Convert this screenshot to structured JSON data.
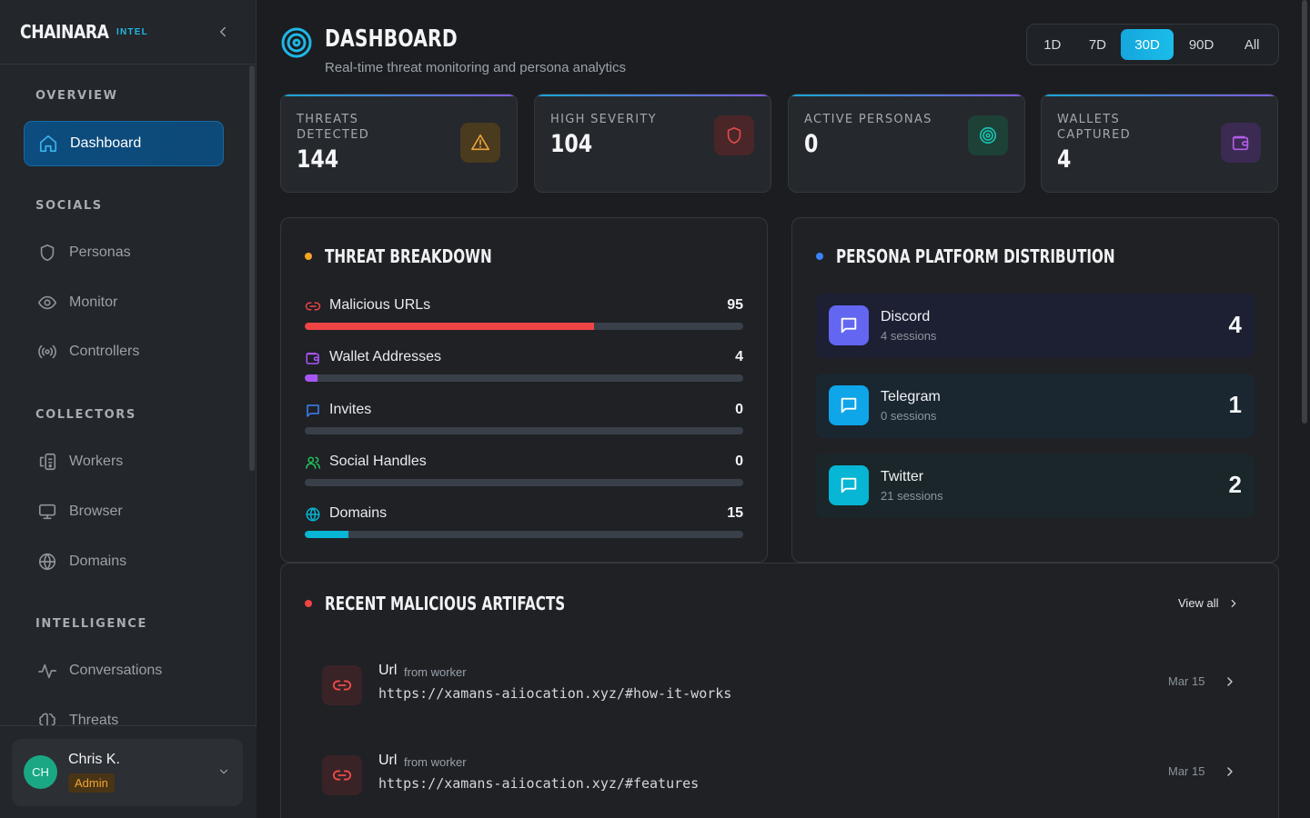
{
  "brand": {
    "name": "CHAINARA",
    "tag": "INTEL"
  },
  "sidebar": {
    "sections": [
      {
        "title": "OVERVIEW",
        "items": [
          {
            "label": "Dashboard",
            "icon": "home-icon",
            "active": true
          }
        ]
      },
      {
        "title": "SOCIALS",
        "items": [
          {
            "label": "Personas",
            "icon": "shield-icon"
          },
          {
            "label": "Monitor",
            "icon": "eye-icon"
          },
          {
            "label": "Controllers",
            "icon": "radio-icon"
          }
        ]
      },
      {
        "title": "COLLECTORS",
        "items": [
          {
            "label": "Workers",
            "icon": "worker-icon"
          },
          {
            "label": "Browser",
            "icon": "monitor-icon"
          },
          {
            "label": "Domains",
            "icon": "globe-icon"
          }
        ]
      },
      {
        "title": "INTELLIGENCE",
        "items": [
          {
            "label": "Conversations",
            "icon": "activity-icon"
          },
          {
            "label": "Threats",
            "icon": "brain-icon"
          }
        ]
      }
    ]
  },
  "user": {
    "initials": "CH",
    "name": "Chris K.",
    "role": "Admin"
  },
  "header": {
    "title": "DASHBOARD",
    "subtitle": "Real-time threat monitoring and persona analytics",
    "ranges": [
      "1D",
      "7D",
      "30D",
      "90D",
      "All"
    ],
    "active_range": "30D"
  },
  "stats": [
    {
      "label": "THREATS DETECTED",
      "value": "144",
      "icon": "alert-triangle-icon",
      "color": "#e9a23b",
      "bg": "#4a3a1e"
    },
    {
      "label": "HIGH SEVERITY",
      "value": "104",
      "icon": "shield-icon",
      "color": "#e04a4a",
      "bg": "#4a2628"
    },
    {
      "label": "ACTIVE PERSONAS",
      "value": "0",
      "icon": "target-icon",
      "color": "#19c0b0",
      "bg": "#1d4136"
    },
    {
      "label": "WALLETS CAPTURED",
      "value": "4",
      "icon": "wallet-icon",
      "color": "#b35ee8",
      "bg": "#3b2a52"
    }
  ],
  "threat_breakdown": {
    "title": "THREAT BREAKDOWN",
    "dot_color": "#f5a524",
    "rows": [
      {
        "label": "Malicious URLs",
        "value": "95",
        "fraction": 0.66,
        "color": "#ef4444",
        "icon": "link-icon"
      },
      {
        "label": "Wallet Addresses",
        "value": "4",
        "fraction": 0.03,
        "color": "#a855f7",
        "icon": "wallet-icon"
      },
      {
        "label": "Invites",
        "value": "0",
        "fraction": 0,
        "color": "#3b82f6",
        "icon": "message-icon"
      },
      {
        "label": "Social Handles",
        "value": "0",
        "fraction": 0,
        "color": "#22c55e",
        "icon": "users-icon"
      },
      {
        "label": "Domains",
        "value": "15",
        "fraction": 0.1,
        "color": "#06b6d4",
        "icon": "globe-icon"
      }
    ]
  },
  "platform_distribution": {
    "title": "PERSONA PLATFORM DISTRIBUTION",
    "dot_color": "#3b82f6",
    "rows": [
      {
        "name": "Discord",
        "sessions": "4 sessions",
        "count": "4",
        "icon_bg": "#6366f1",
        "row_bg": "#1d1f33"
      },
      {
        "name": "Telegram",
        "sessions": "0 sessions",
        "count": "1",
        "icon_bg": "#0ea5e9",
        "row_bg": "#1a2630"
      },
      {
        "name": "Twitter",
        "sessions": "21 sessions",
        "count": "2",
        "icon_bg": "#06b6d4",
        "row_bg": "#1a2629"
      }
    ]
  },
  "recent": {
    "title": "RECENT MALICIOUS ARTIFACTS",
    "dot_color": "#ef4444",
    "view_all": "View all",
    "items": [
      {
        "type": "Url",
        "from": "from worker",
        "url": "https://xamans-aiiocation.xyz/#how-it-works",
        "date": "Mar 15"
      },
      {
        "type": "Url",
        "from": "from worker",
        "url": "https://xamans-aiiocation.xyz/#features",
        "date": "Mar 15"
      }
    ]
  }
}
